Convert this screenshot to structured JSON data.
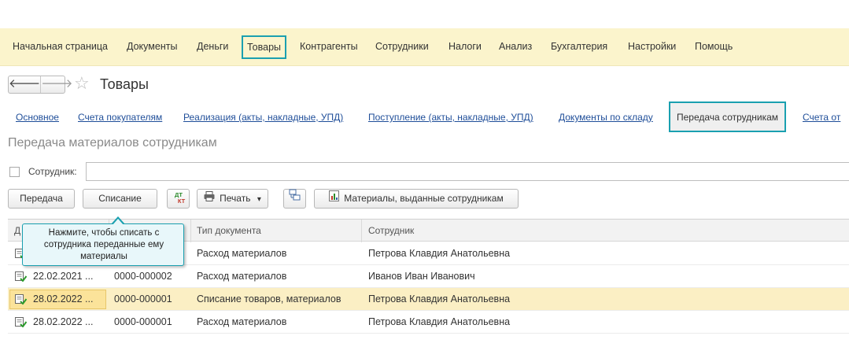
{
  "topnav": {
    "items": [
      {
        "label": "Начальная страница"
      },
      {
        "label": "Документы"
      },
      {
        "label": "Деньги"
      },
      {
        "label": "Товары",
        "active": true
      },
      {
        "label": "Контрагенты"
      },
      {
        "label": "Сотрудники"
      },
      {
        "label": "Налоги"
      },
      {
        "label": "Анализ"
      },
      {
        "label": "Бухгалтерия"
      },
      {
        "label": "Настройки"
      },
      {
        "label": "Помощь"
      }
    ]
  },
  "header": {
    "back_glyph": "🡐",
    "forward_glyph": "🡒",
    "star_glyph": "☆",
    "title": "Товары"
  },
  "subnav": {
    "tabs": [
      {
        "label": "Основное"
      },
      {
        "label": "Счета покупателям"
      },
      {
        "label": "Реализация (акты, накладные, УПД)"
      },
      {
        "label": "Поступление (акты, накладные, УПД)"
      },
      {
        "label": "Документы по складу"
      },
      {
        "label": "Передача сотрудникам",
        "active": true
      },
      {
        "label": "Счета от"
      }
    ]
  },
  "section": {
    "title": "Передача материалов сотрудникам"
  },
  "filter": {
    "label": "Сотрудник:",
    "value": ""
  },
  "toolbar": {
    "transfer_label": "Передача",
    "writeoff_label": "Списание",
    "dtkt_top": "ДТ",
    "dtkt_bottom": "КТ",
    "print_label": "Печать",
    "print_arrow": "▾",
    "report_label": "Материалы, выданные сотрудникам"
  },
  "table": {
    "columns": {
      "date": "Д",
      "type": "Тип документа",
      "employee": "Сотрудник"
    },
    "rows": [
      {
        "date": "",
        "number": "",
        "type": "Расход материалов",
        "employee": "Петрова Клавдия Анатольевна",
        "selected": false
      },
      {
        "date": "22.02.2021 ...",
        "number": "0000-000002",
        "type": "Расход материалов",
        "employee": "Иванов Иван Иванович",
        "selected": false
      },
      {
        "date": "28.02.2022 ...",
        "number": "0000-000001",
        "type": "Списание товаров, материалов",
        "employee": "Петрова Клавдия Анатольевна",
        "selected": true
      },
      {
        "date": "28.02.2022 ...",
        "number": "0000-000001",
        "type": "Расход материалов",
        "employee": "Петрова Клавдия Анатольевна",
        "selected": false
      }
    ]
  },
  "tooltip": {
    "text": "Нажмите, чтобы списать с сотрудника переданные ему материалы"
  },
  "colors": {
    "topbar_bg": "#fbf4cc",
    "highlight_border": "#1aa0b0",
    "link": "#1f4e99",
    "selected_row": "#fbefc4"
  }
}
